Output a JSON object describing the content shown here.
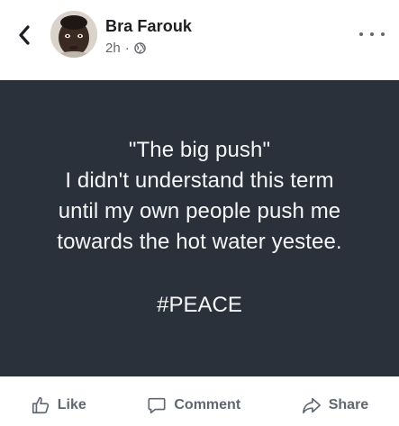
{
  "header": {
    "author_name": "Bra Farouk",
    "timestamp": "2h",
    "separator": "·",
    "privacy_icon": "globe-icon",
    "back_icon": "chevron-left-icon",
    "more_icon": "more-horizontal-icon"
  },
  "post": {
    "background_color": "#2b313a",
    "text_color": "#f4f6f8",
    "quote": "\"The big push\"\nI didn't understand this term\nuntil my own people push me\ntowards the hot water yestee.",
    "hashtag": "#PEACE"
  },
  "actions": {
    "like_label": "Like",
    "like_icon": "thumbs-up-icon",
    "comment_label": "Comment",
    "comment_icon": "comment-bubble-icon",
    "share_label": "Share",
    "share_icon": "share-arrow-icon"
  }
}
